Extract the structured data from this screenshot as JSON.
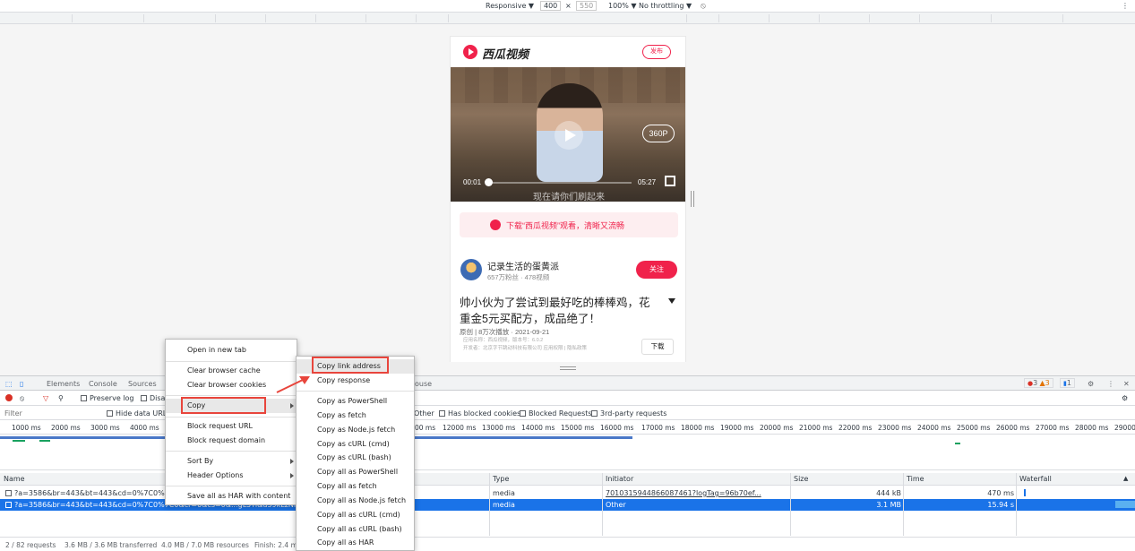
{
  "device_toolbar": {
    "device": "Responsive ▼",
    "width": "400",
    "times": "×",
    "height": "550",
    "zoom": "100% ▼",
    "throttle": "No throttling ▼",
    "rotate_icon": "rotate-icon",
    "more": "⋮"
  },
  "page": {
    "brand": "西瓜视频",
    "publish": "发布",
    "quality": "360P",
    "time_current": "00:01",
    "time_total": "05:27",
    "subtitle": "现在请你们刷起来",
    "banner": "下载“西瓜视频”观看，清晰又流畅",
    "author_name": "记录生活的蛋黄派",
    "author_stats": "657万粉丝 · 478视频",
    "follow": "关注",
    "title": "帅小伙为了尝试到最好吃的棒棒鸡，花重金5元买配方，成品绝了！",
    "meta": "原创 | 8万次播放 · 2021-09-21",
    "app_line1": "应用名称：西瓜视频，版本号：6.0.2",
    "app_line2": "开发者：北京字节跳动科技有限公司 应用权限 | 隐私政策",
    "download": "下载"
  },
  "devtools": {
    "tabs": [
      "Elements",
      "Console",
      "Sources"
    ],
    "tab_partial": "ouse",
    "badges": {
      "errors": "3",
      "warnings": "3",
      "messages": "1"
    },
    "toolbar": {
      "preserve_log": "Preserve log",
      "disable_cache": "Disa"
    },
    "filter_placeholder": "Filter",
    "hide_data_urls": "Hide data URLs",
    "filter_types": [
      "Other"
    ],
    "has_blocked_cookies": "Has blocked cookies",
    "blocked_requests": "Blocked Requests",
    "third_party": "3rd-party requests",
    "timeline_ticks_left": [
      "1000 ms",
      "2000 ms",
      "3000 ms",
      "4000 ms"
    ],
    "timeline_ticks_right": [
      "00 ms",
      "12000 ms",
      "13000 ms",
      "14000 ms",
      "15000 ms",
      "16000 ms",
      "17000 ms",
      "18000 ms",
      "19000 ms",
      "20000 ms",
      "21000 ms",
      "22000 ms",
      "23000 ms",
      "24000 ms",
      "25000 ms",
      "26000 ms",
      "27000 ms",
      "28000 ms",
      "29000"
    ],
    "columns": [
      "Name",
      "Type",
      "Initiator",
      "Size",
      "Time",
      "Waterfall"
    ],
    "rows": [
      {
        "name": "?a=3586&br=443&bt=443&cd=0%7C0%7C0&c",
        "type": "media",
        "initiator": "7010315944866087461?logTag=96b70ef...",
        "size": "444 kB",
        "time": "470 ms"
      },
      {
        "name": "?a=3586&br=443&bt=443&cd=0%7C0%7C0&cr=0&cs=0&...gL5Ti&d39kLzNiT5g",
        "type": "media",
        "initiator": "Other",
        "size": "3.1 MB",
        "time": "15.94 s"
      }
    ],
    "status": {
      "requests": "2 / 82 requests",
      "transferred": "3.6 MB / 3.6 MB transferred",
      "resources": "4.0 MB / 7.0 MB resources",
      "finish": "Finish: 2.4 mi"
    }
  },
  "context_menu": {
    "items": [
      "Open in new tab",
      "Clear browser cache",
      "Clear browser cookies",
      "Copy",
      "Block request URL",
      "Block request domain",
      "Sort By",
      "Header Options",
      "Save all as HAR with content"
    ]
  },
  "copy_submenu": {
    "items": [
      "Copy link address",
      "Copy response",
      "Copy as PowerShell",
      "Copy as fetch",
      "Copy as Node.js fetch",
      "Copy as cURL (cmd)",
      "Copy as cURL (bash)",
      "Copy all as PowerShell",
      "Copy all as fetch",
      "Copy all as Node.js fetch",
      "Copy all as cURL (cmd)",
      "Copy all as cURL (bash)",
      "Copy all as HAR"
    ]
  },
  "colors": {
    "accent": "#f0224b",
    "highlight": "#e8453c",
    "selection": "#1a73e8"
  }
}
